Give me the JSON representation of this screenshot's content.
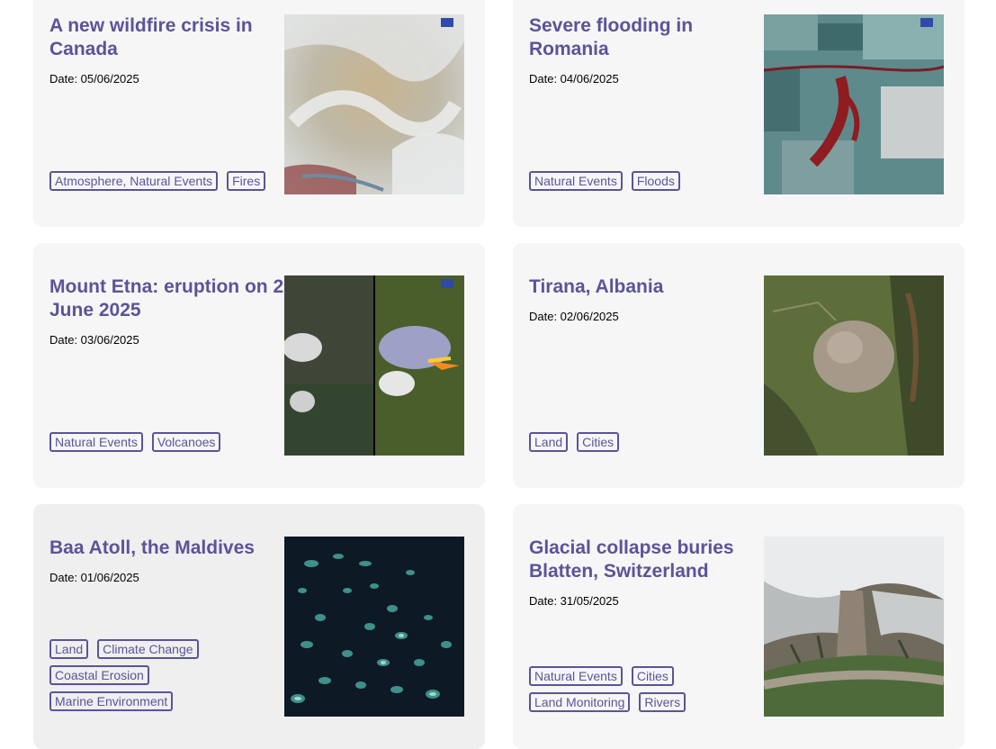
{
  "cards": [
    {
      "title": "A new wildfire crisis in Canada",
      "date": "Date: 05/06/2025",
      "tags": [
        "Atmosphere, Natural Events",
        "Fires"
      ]
    },
    {
      "title": "Severe flooding in Romania",
      "date": "Date: 04/06/2025",
      "tags": [
        "Natural Events",
        "Floods"
      ]
    },
    {
      "title": "Mount Etna: eruption on 2 June 2025",
      "date": "Date: 03/06/2025",
      "tags": [
        "Natural Events",
        "Volcanoes"
      ]
    },
    {
      "title": "Tirana, Albania",
      "date": "Date: 02/06/2025",
      "tags": [
        "Land",
        "Cities"
      ]
    },
    {
      "title": "Baa Atoll, the Maldives",
      "date": "Date: 01/06/2025",
      "tags": [
        "Land",
        "Climate Change",
        "Coastal Erosion",
        "Marine Environment"
      ]
    },
    {
      "title": "Glacial collapse buries Blatten, Switzerland",
      "date": "Date: 31/05/2025",
      "tags": [
        "Natural Events",
        "Cities",
        "Land Monitoring",
        "Rivers"
      ]
    }
  ]
}
